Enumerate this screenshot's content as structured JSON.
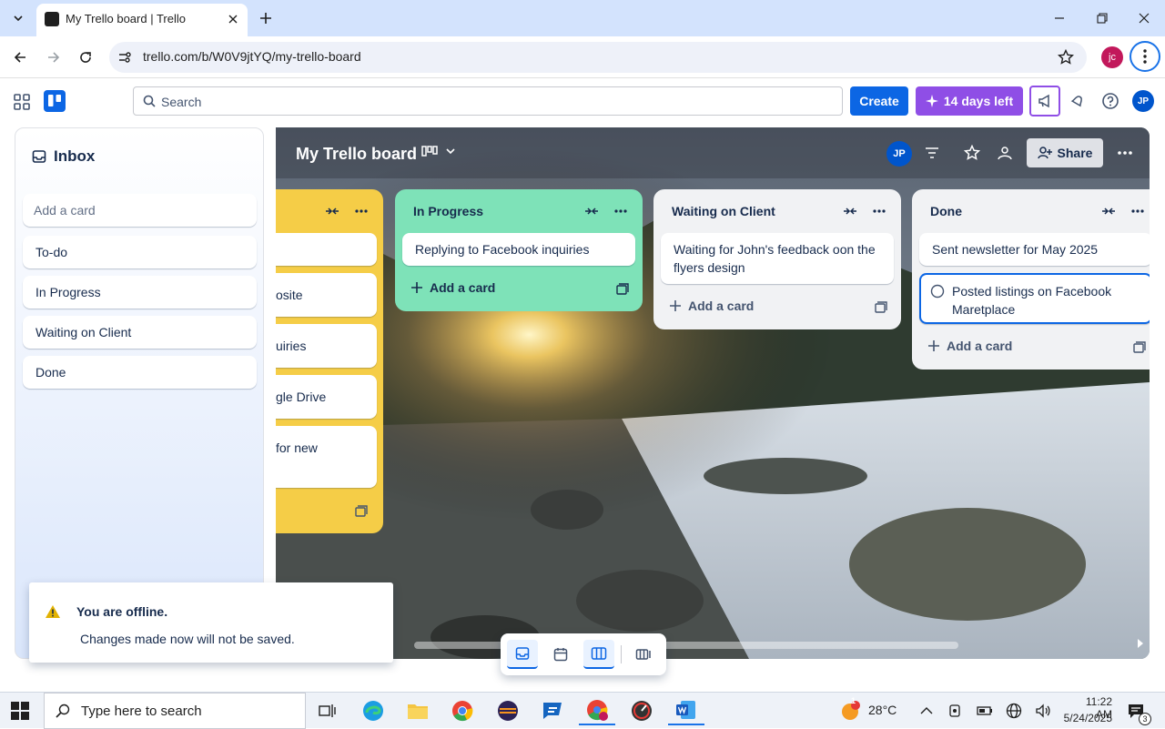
{
  "browser": {
    "tab_title": "My Trello board | Trello",
    "url": "trello.com/b/W0V9jtYQ/my-trello-board",
    "profile_initials": "jc"
  },
  "header": {
    "search_placeholder": "Search",
    "create_label": "Create",
    "trial_label": "14 days left",
    "user_initials": "JP"
  },
  "inbox": {
    "title": "Inbox",
    "add_card_placeholder": "Add a card",
    "items": [
      "To-do",
      "In Progress",
      "Waiting on Client",
      "Done"
    ]
  },
  "board": {
    "title": "My Trello board",
    "member_initials": "JP",
    "share_label": "Share",
    "partial_list": {
      "card_fragments": [
        "osite",
        "uiries",
        "gle Drive",
        "for new"
      ]
    },
    "lists": [
      {
        "title": "In Progress",
        "color": "#7ee2b8",
        "cards": [
          "Replying to Facebook inquiries"
        ],
        "add_label": "Add a card"
      },
      {
        "title": "Waiting on Client",
        "color": "#f1f2f4",
        "cards": [
          "Waiting for John's feedback oon the flyers design"
        ],
        "add_label": "Add a card"
      },
      {
        "title": "Done",
        "color": "#f1f2f4",
        "cards": [
          "Sent newsletter for May 2025",
          "Posted listings on Facebook Maretplace"
        ],
        "add_label": "Add a card"
      }
    ]
  },
  "toast": {
    "title": "You are offline.",
    "message": "Changes made now will not be saved."
  },
  "taskbar": {
    "search_placeholder": "Type here to search",
    "temperature": "28°C",
    "time": "11:22 AM",
    "date": "5/24/2025",
    "notification_count": "3",
    "weather_badge": "1"
  },
  "colors": {
    "brand_blue": "#0c66e4",
    "trial_purple": "#8f4ee6",
    "in_progress_green": "#7ee2b8",
    "todo_yellow": "#f5cd47"
  }
}
